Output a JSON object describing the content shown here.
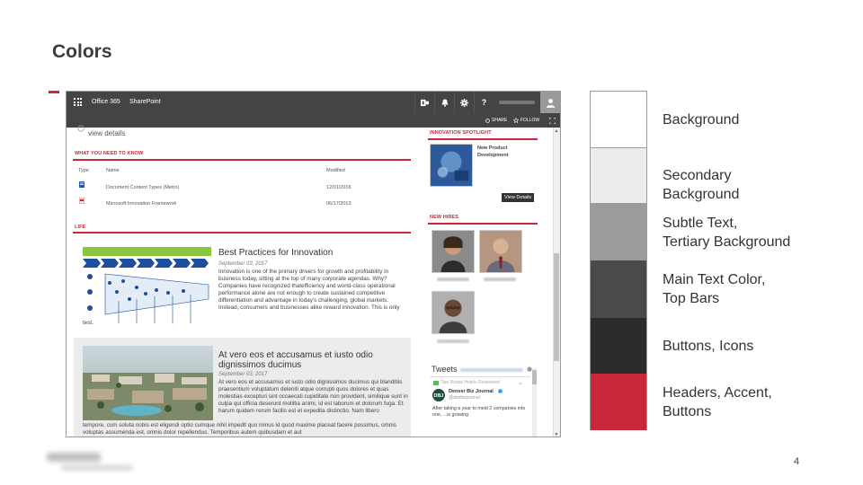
{
  "slide": {
    "title": "Colors",
    "page_number": "4"
  },
  "suite_bar": {
    "app_name": "Office 365",
    "site_name": "SharePoint",
    "icons": [
      "app-launcher-icon",
      "outlook-icon",
      "bell-icon",
      "gear-icon",
      "help-icon",
      "user-avatar-icon"
    ],
    "help_label": "?",
    "actions": {
      "share": "SHARE",
      "follow": "FOLLOW"
    }
  },
  "page": {
    "view_details_top": "view details",
    "what_you_need": {
      "heading": "WHAT YOU NEED TO KNOW",
      "columns": {
        "type": "Type",
        "name": "Name",
        "modified": "Modified"
      },
      "rows": [
        {
          "icon": "word-doc-icon",
          "name": "Document Content Types (Metro)",
          "modified": "12/01/2016"
        },
        {
          "icon": "pdf-doc-icon",
          "name": "Microsoft Innovation Framework",
          "modified": "06/17/2013"
        }
      ]
    },
    "life": {
      "heading": "LIFE",
      "articles": [
        {
          "title": "Best Practices for Innovation",
          "date": "September 03, 2017",
          "body": "Innovation is one of the primary drivers for growth and profitability in business today, sitting at the top of many corporate agendas. Why? Companies have recognized thatefficiency and world-class operational performance alone are not enough to create sustained competitive differentiation and advantage in today's challenging, global markets. Instead, consumers and businesses alike reward innovation. This is only",
          "overflow": "test."
        },
        {
          "title": "At vero eos et accusamus et iusto odio dignissimos ducimus",
          "date": "September 03, 2017",
          "body": "At vero eos et accusamus et iusto odio dignissimos ducimus qui blanditiis praesentium voluptatum deleniti atque corrupti quos dolores et quas molestias excepturi sint occaecati cupiditate non provident, similique sunt in culpa qui officia deserunt mollitia animi, id est laborum et dolorum fuga. Et harum quidem rerum facilis est et expedita distinctio. Nam libero",
          "overflow": "tempore, cum soluta nobis est eligendi optio cumque nihil impedit quo minus id quod maxime placeat facere possimus, omnis voluptas assumenda est, omnis dolor repellendus. Temporibus autem quibusdam et aut"
        }
      ]
    },
    "spotlight": {
      "heading": "INNOVATION SPOTLIGHT",
      "item_title": "New Product Development",
      "button": "View Details"
    },
    "new_hires": {
      "heading": "NEW HIRES"
    },
    "tweets": {
      "title": "Tweets",
      "retweet_note": "Two Roads Hotels Retweeted",
      "author": "Denver Biz Journal",
      "handle": "@denbizjournal",
      "text": "After taking a year to meld 2 companies into one, ...is growing"
    }
  },
  "palette": [
    {
      "color": "#ffffff",
      "label": "Background"
    },
    {
      "color": "#ececec",
      "label": "Secondary\nBackground"
    },
    {
      "color": "#9b9b9b",
      "label": "Subtle Text,\nTertiary Background"
    },
    {
      "color": "#4a4a4a",
      "label": "Main Text Color,\nTop Bars"
    },
    {
      "color": "#2b2b2b",
      "label": "Buttons, Icons"
    },
    {
      "color": "#c8283a",
      "label": "Headers, Accent,\nButtons"
    }
  ],
  "colors": {
    "accent": "#c8283a",
    "top_bar": "#444444"
  }
}
